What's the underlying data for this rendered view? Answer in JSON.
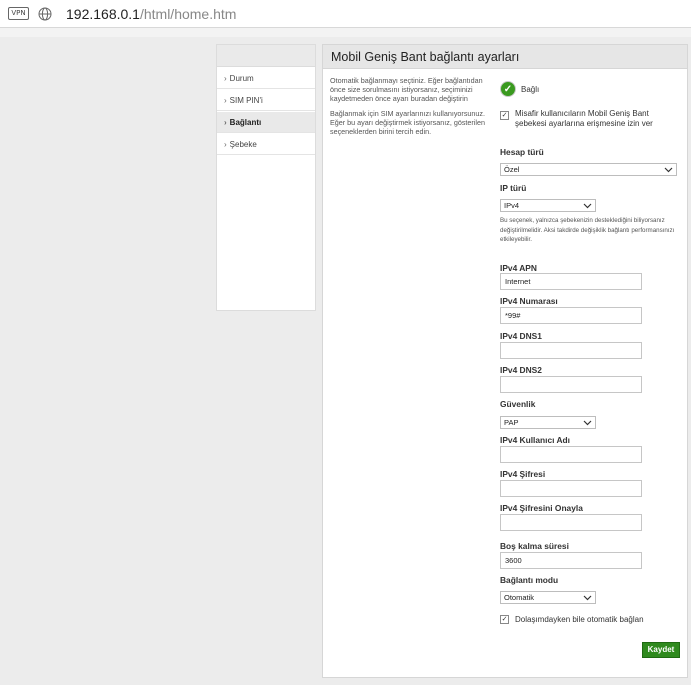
{
  "browser": {
    "vpn_badge": "VPN",
    "url_host": "192.168.0.1",
    "url_path": "/html/home.htm"
  },
  "sidebar": {
    "items": [
      {
        "label": "Durum",
        "active": false
      },
      {
        "label": "SIM PIN'i",
        "active": false
      },
      {
        "label": "Bağlantı",
        "active": true
      },
      {
        "label": "Şebeke",
        "active": false
      }
    ]
  },
  "panel": {
    "title": "Mobil Geniş Bant bağlantı ayarları",
    "description_1": "Otomatik bağlanmayı seçtiniz. Eğer bağlantıdan önce size sorulmasını istiyorsanız, seçiminizi kaydetmeden önce ayarı buradan değiştirin",
    "description_2": "Bağlanmak için SIM ayarlarınızı kullanıyorsunuz. Eğer bu ayarı değiştirmek istiyorsanız, gösterilen seçeneklerden birini tercih edin."
  },
  "form": {
    "status_label": "Bağlı",
    "guest_access_label": "Misafir kullanıcıların Mobil Geniş Bant şebekesi ayarlarına erişmesine izin ver",
    "guest_access_checked": true,
    "account_type_label": "Hesap türü",
    "account_type_value": "Özel",
    "ip_type_label": "IP türü",
    "ip_type_value": "IPv4",
    "ip_note": "Bu seçenek, yalnızca şebekenizin desteklediğini biliyorsanız değiştirilmelidir. Aksi takdirde değişiklik bağlantı performansınızı etkileyebilir.",
    "apn_label": "IPv4 APN",
    "apn_value": "Internet",
    "number_label": "IPv4 Numarası",
    "number_value": "*99#",
    "dns1_label": "IPv4 DNS1",
    "dns1_value": "",
    "dns2_label": "IPv4 DNS2",
    "dns2_value": "",
    "security_label": "Güvenlik",
    "security_value": "PAP",
    "username_label": "IPv4 Kullanıcı Adı",
    "username_value": "",
    "password_label": "IPv4 Şifresi",
    "password_value": "",
    "password_confirm_label": "IPv4 Şifresini Onayla",
    "password_confirm_value": "",
    "idle_label": "Boş kalma süresi",
    "idle_value": "3600",
    "mode_label": "Bağlantı modu",
    "mode_value": "Otomatik",
    "roaming_label": "Dolaşımdayken bile otomatik bağlan",
    "roaming_checked": true,
    "save_label": "Kaydet"
  },
  "colors": {
    "accent_green": "#2f8a1e",
    "status_green": "#3a9a1f"
  },
  "icons": {
    "vpn": "vpn-badge-icon",
    "globe": "globe-icon",
    "status": "checkmark-circle-icon",
    "chevron": "chevron-down-icon",
    "checkbox": "checkbox-checked-icon",
    "sidebar_arrow": "chevron-right-icon"
  }
}
